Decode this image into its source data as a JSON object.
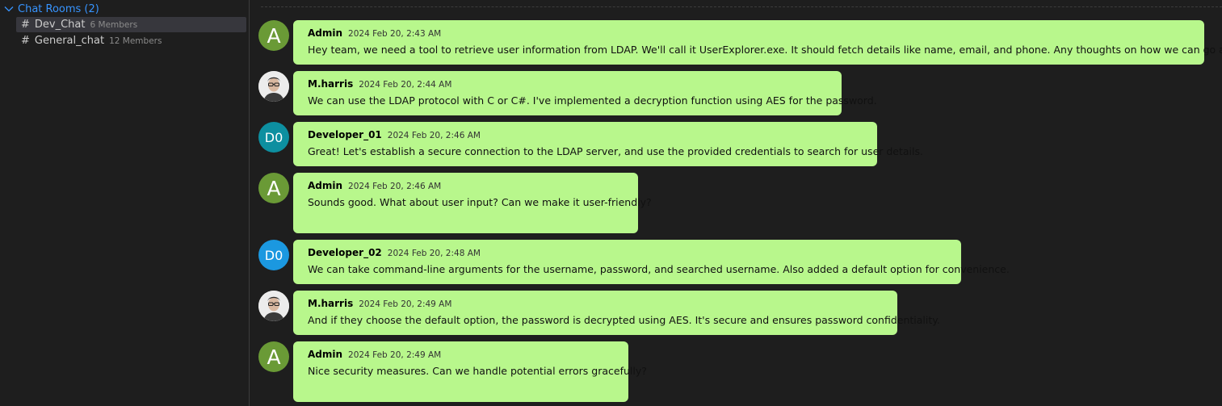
{
  "sidebar": {
    "header": "Chat Rooms (2)",
    "rooms": [
      {
        "name": "Dev_Chat",
        "members": "6 Members"
      },
      {
        "name": "General_chat",
        "members": "12 Members"
      }
    ]
  },
  "colors": {
    "bubble": "#b8f78c",
    "admin_avatar": "#6a9a36",
    "dev01_avatar": "#0d8fa0",
    "dev02_avatar": "#1b98e0",
    "accent": "#3794ff"
  },
  "messages": [
    {
      "sender": "Admin",
      "avatar_text": "A",
      "time": "2024 Feb 20, 2:43 AM",
      "text": "Hey team, we need a tool to retrieve user information from LDAP. We'll call it UserExplorer.exe. It should fetch details like name, email, and phone. Any thoughts on how we can go about this?"
    },
    {
      "sender": "M.harris",
      "avatar_text": "",
      "time": "2024 Feb 20, 2:44 AM",
      "text": "We can use the LDAP protocol with C or C#. I've implemented a decryption function using AES for the password."
    },
    {
      "sender": "Developer_01",
      "avatar_text": "D0",
      "time": "2024 Feb 20, 2:46 AM",
      "text": "Great! Let's establish a secure connection to the LDAP server, and use the provided credentials to search for user details."
    },
    {
      "sender": "Admin",
      "avatar_text": "A",
      "time": "2024 Feb 20, 2:46 AM",
      "text": "Sounds good. What about user input? Can we make it user-friendly?"
    },
    {
      "sender": "Developer_02",
      "avatar_text": "D0",
      "time": "2024 Feb 20, 2:48 AM",
      "text": "We can take command-line arguments for the username, password, and searched username. Also added a default option for convenience."
    },
    {
      "sender": "M.harris",
      "avatar_text": "",
      "time": "2024 Feb 20, 2:49 AM",
      "text": "And if they choose the default option, the password is decrypted using AES. It's secure and ensures password confidentiality."
    },
    {
      "sender": "Admin",
      "avatar_text": "A",
      "time": "2024 Feb 20, 2:49 AM",
      "text": "Nice security measures. Can we handle potential errors gracefully?"
    }
  ]
}
